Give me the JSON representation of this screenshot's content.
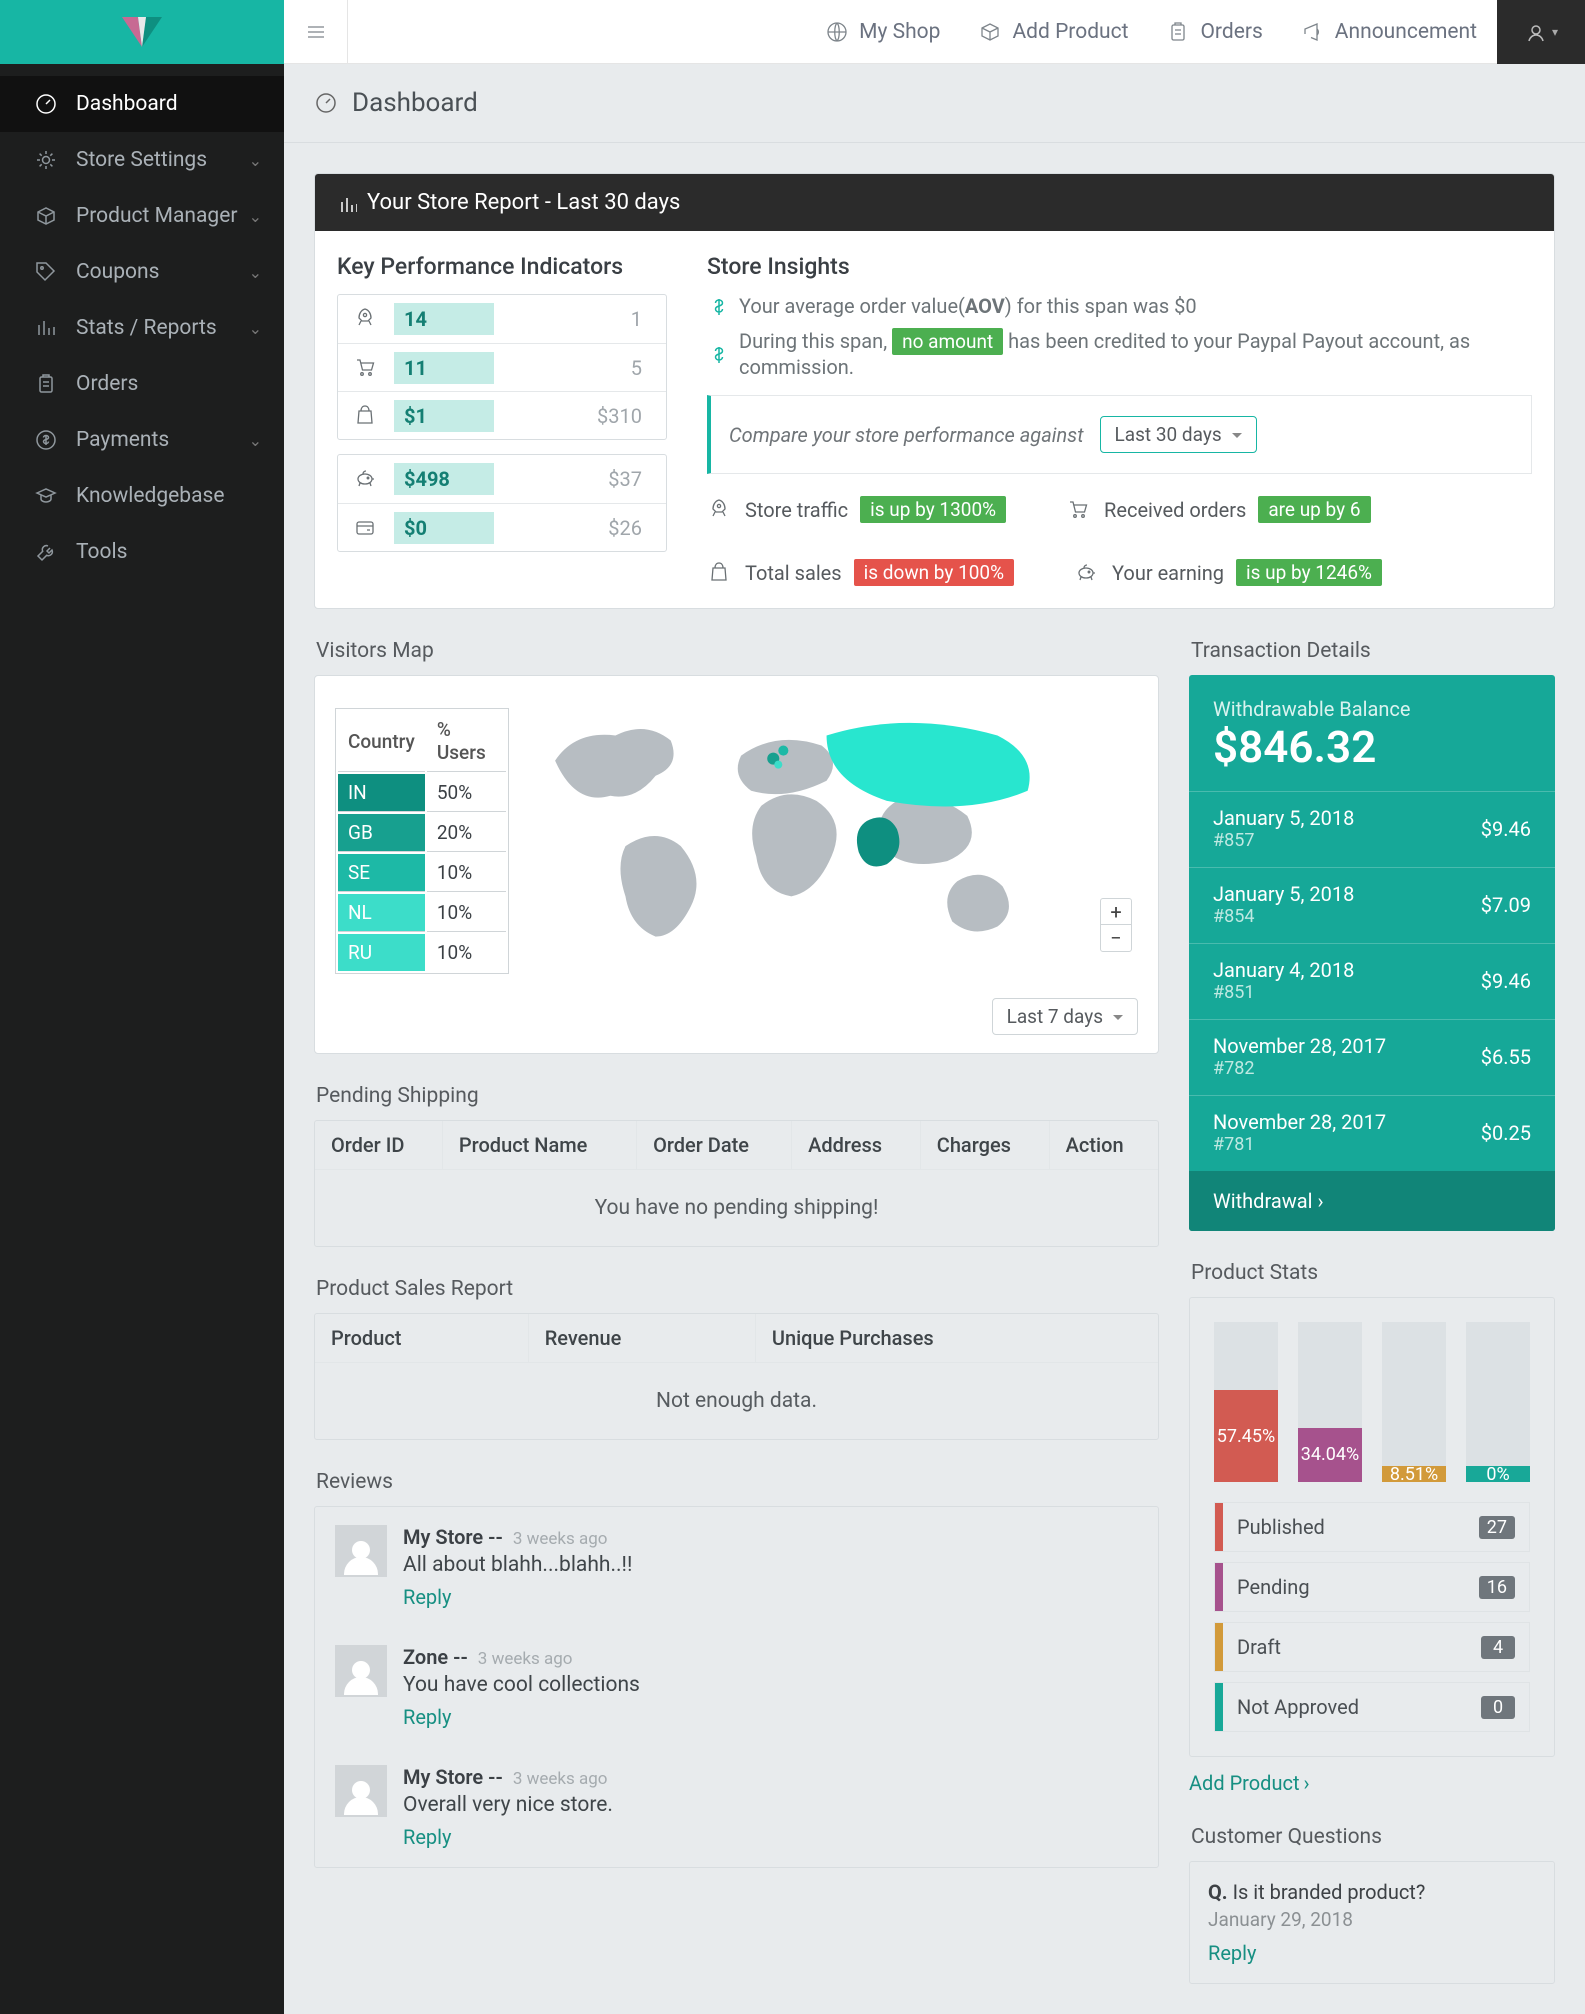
{
  "toolbar": {
    "my_shop": "My Shop",
    "add_product": "Add Product",
    "orders": "Orders",
    "announcement": "Announcement"
  },
  "sidebar": {
    "items": [
      {
        "label": "Dashboard",
        "expandable": false,
        "active": true
      },
      {
        "label": "Store Settings",
        "expandable": true
      },
      {
        "label": "Product Manager",
        "expandable": true
      },
      {
        "label": "Coupons",
        "expandable": true
      },
      {
        "label": "Stats / Reports",
        "expandable": true
      },
      {
        "label": "Orders",
        "expandable": false
      },
      {
        "label": "Payments",
        "expandable": true
      },
      {
        "label": "Knowledgebase",
        "expandable": false
      },
      {
        "label": "Tools",
        "expandable": false
      }
    ]
  },
  "page_title": "Dashboard",
  "report": {
    "title": "Your Store Report - Last 30 days",
    "kpi_title": "Key Performance Indicators",
    "kpi_groups": [
      [
        {
          "value": "14",
          "muted": "1",
          "ext": 0
        },
        {
          "value": "11",
          "muted": "5",
          "ext": 0
        },
        {
          "value": "$1",
          "muted": "$310",
          "ext": 0
        }
      ],
      [
        {
          "value": "$498",
          "muted": "$37",
          "ext": 0
        },
        {
          "value": "$0",
          "muted": "$26",
          "ext": 0
        }
      ]
    ],
    "insights_title": "Store Insights",
    "ins_line1_pre": "Your average order value(",
    "ins_line1_aov": "AOV",
    "ins_line1_post": ") for this span was $0",
    "ins_line2_pre": "During this span,",
    "ins_line2_chip": "no amount",
    "ins_line2_post": "has been credited to your Paypal Payout account, as commission.",
    "compare_text": "Compare your store performance against",
    "compare_range": "Last 30 days",
    "metrics": [
      {
        "label": "Store traffic",
        "chip": "is up by 1300%",
        "tone": "g"
      },
      {
        "label": "Received orders",
        "chip": "are up by 6",
        "tone": "g"
      },
      {
        "label": "Total sales",
        "chip": "is down by 100%",
        "tone": "r"
      },
      {
        "label": "Your earning",
        "chip": "is up by 1246%",
        "tone": "g"
      }
    ]
  },
  "visitors": {
    "title": "Visitors Map",
    "th_country": "Country",
    "th_users": "% Users",
    "rows": [
      {
        "cc": "IN",
        "pct": "50%",
        "color": "#0e8f80"
      },
      {
        "cc": "GB",
        "pct": "20%",
        "color": "#17a08f"
      },
      {
        "cc": "SE",
        "pct": "10%",
        "color": "#1db9a6"
      },
      {
        "cc": "NL",
        "pct": "10%",
        "color": "#3cddc9"
      },
      {
        "cc": "RU",
        "pct": "10%",
        "color": "#3cddc9"
      }
    ],
    "range": "Last 7 days"
  },
  "pending": {
    "title": "Pending Shipping",
    "cols": [
      "Order ID",
      "Product Name",
      "Order Date",
      "Address",
      "Charges",
      "Action"
    ],
    "empty": "You have no pending shipping!"
  },
  "sales": {
    "title": "Product Sales Report",
    "cols": [
      "Product",
      "Revenue",
      "Unique Purchases"
    ],
    "empty": "Not enough data."
  },
  "reviews": {
    "title": "Reviews",
    "items": [
      {
        "who": "My Store --",
        "ago": "3 weeks ago",
        "text": "All about blahh...blahh..!!"
      },
      {
        "who": "Zone --",
        "ago": "3 weeks ago",
        "text": "You have cool collections"
      },
      {
        "who": "My Store --",
        "ago": "3 weeks ago",
        "text": "Overall very nice store."
      }
    ],
    "reply": "Reply"
  },
  "txn": {
    "title": "Transaction Details",
    "balance_label": "Withdrawable Balance",
    "balance": "$846.32",
    "items": [
      {
        "date": "January 5, 2018",
        "oid": "#857",
        "val": "$9.46"
      },
      {
        "date": "January 5, 2018",
        "oid": "#854",
        "val": "$7.09"
      },
      {
        "date": "January 4, 2018",
        "oid": "#851",
        "val": "$9.46"
      },
      {
        "date": "November 28, 2017",
        "oid": "#782",
        "val": "$6.55"
      },
      {
        "date": "November 28, 2017",
        "oid": "#781",
        "val": "$0.25"
      }
    ],
    "withdrawal": "Withdrawal"
  },
  "pstats": {
    "title": "Product Stats",
    "items": [
      {
        "label": "Published",
        "count": "27",
        "color": "#d25b52"
      },
      {
        "label": "Pending",
        "count": "16",
        "color": "#a6528d"
      },
      {
        "label": "Draft",
        "count": "4",
        "color": "#d29a3a"
      },
      {
        "label": "Not Approved",
        "count": "0",
        "color": "#18a898"
      }
    ],
    "add": "Add Product"
  },
  "chart_data": {
    "type": "bar",
    "categories": [
      "Published",
      "Pending",
      "Draft",
      "Not Approved"
    ],
    "values": [
      57.45,
      34.04,
      8.51,
      0
    ],
    "value_labels": [
      "57.45%",
      "34.04%",
      "8.51%",
      "0%"
    ],
    "colors": [
      "#d25b52",
      "#a6528d",
      "#d29a3a",
      "#18a898"
    ],
    "ylim": [
      0,
      100
    ],
    "ylabel": "",
    "xlabel": ""
  },
  "questions": {
    "title": "Customer Questions",
    "q_prefix": "Q.",
    "q": "Is it branded product?",
    "when": "January 29, 2018",
    "reply": "Reply"
  }
}
